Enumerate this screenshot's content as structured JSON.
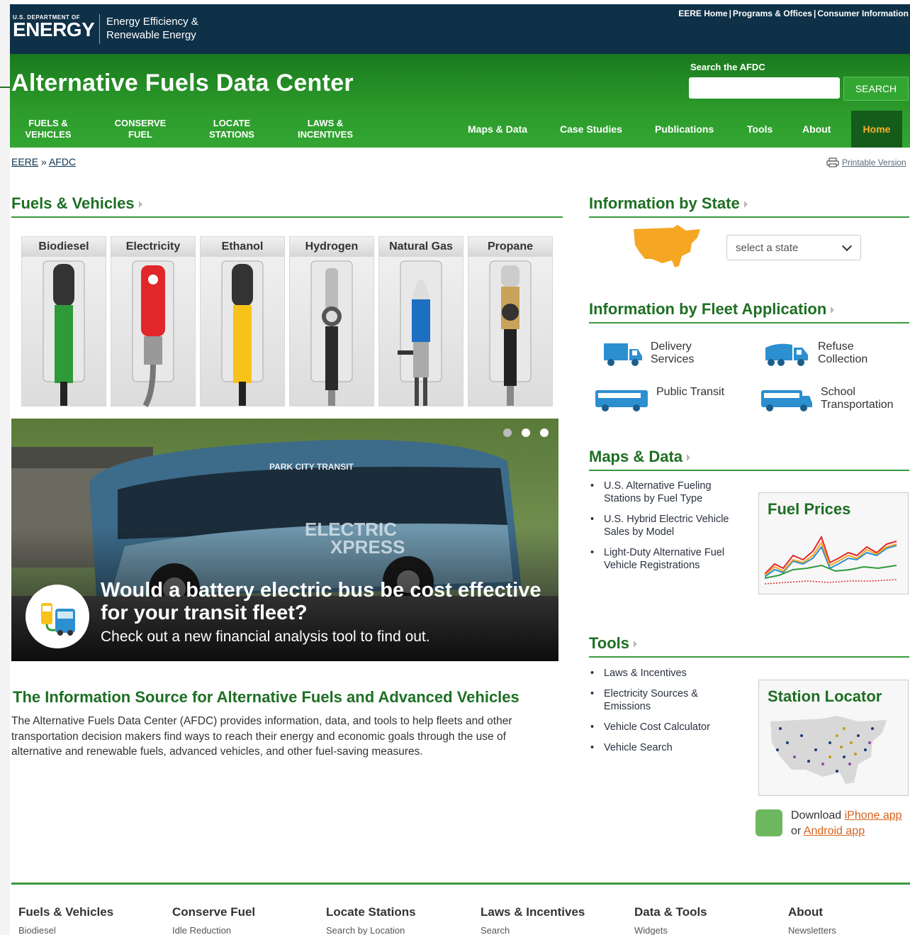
{
  "header": {
    "agency_small": "U.S. DEPARTMENT OF",
    "agency_big": "ENERGY",
    "office_line1": "Energy Efficiency &",
    "office_line2": "Renewable Energy",
    "top_links": [
      "EERE Home",
      "Programs & Offices",
      "Consumer Information"
    ],
    "site_title": "Alternative Fuels Data Center",
    "search_label": "Search the AFDC",
    "search_value": "",
    "search_button": "SEARCH"
  },
  "nav": {
    "primary": [
      {
        "line1": "FUELS &",
        "line2": "VEHICLES"
      },
      {
        "line1": "CONSERVE",
        "line2": "FUEL"
      },
      {
        "line1": "LOCATE",
        "line2": "STATIONS"
      },
      {
        "line1": "LAWS &",
        "line2": "INCENTIVES"
      }
    ],
    "secondary": [
      "Maps & Data",
      "Case Studies",
      "Publications",
      "Tools",
      "About"
    ],
    "home": "Home"
  },
  "breadcrumb": {
    "items": [
      "EERE",
      "AFDC"
    ],
    "separator": "»"
  },
  "printable": "Printable Version",
  "fuels_section": {
    "heading": "Fuels & Vehicles",
    "fuels": [
      {
        "label": "Biodiesel",
        "color": "#2e9a3a"
      },
      {
        "label": "Electricity",
        "color": "#e2272a"
      },
      {
        "label": "Ethanol",
        "color": "#f7c21a"
      },
      {
        "label": "Hydrogen",
        "color": "#9a9a9a"
      },
      {
        "label": "Natural Gas",
        "color": "#1d6fc2"
      },
      {
        "label": "Propane",
        "color": "#c9a35a"
      }
    ]
  },
  "hero": {
    "headline_line1": "Would a battery electric bus be cost effective",
    "headline_line2": "for your transit fleet?",
    "subtext": "Check out a new financial analysis tool to find out.",
    "bus_texts": {
      "brand": "PARK CITY TRANSIT",
      "name1": "ELECTRIC",
      "name2": "XPRESS"
    },
    "slide_count": 3,
    "active_slide": 1
  },
  "intro": {
    "heading": "The Information Source for Alternative Fuels and Advanced Vehicles",
    "paragraph": "The Alternative Fuels Data Center (AFDC) provides information, data, and tools to help fleets and other transportation decision makers find ways to reach their energy and economic goals through the use of alternative and renewable fuels, advanced vehicles, and other fuel-saving measures."
  },
  "state_section": {
    "heading": "Information by State",
    "select_placeholder": "select a state"
  },
  "fleet_section": {
    "heading": "Information by Fleet Application",
    "items": [
      {
        "line1": "Delivery",
        "line2": "Services"
      },
      {
        "line1": "Refuse",
        "line2": "Collection"
      },
      {
        "line1": "Public Transit",
        "line2": ""
      },
      {
        "line1": "School",
        "line2": "Transportation"
      }
    ]
  },
  "maps_section": {
    "heading": "Maps & Data",
    "links": [
      {
        "line1": "U.S. Alternative Fueling",
        "line2": "Stations by Fuel Type"
      },
      {
        "line1": "U.S. Hybrid Electric Vehicle",
        "line2": "Sales by Model"
      },
      {
        "line1": "Light-Duty Alternative Fuel",
        "line2": "Vehicle Registrations"
      }
    ],
    "card_title": "Fuel Prices"
  },
  "tools_section": {
    "heading": "Tools",
    "links": [
      {
        "line1": "Laws & Incentives",
        "line2": ""
      },
      {
        "line1": "Electricity Sources &",
        "line2": "Emissions"
      },
      {
        "line1": "Vehicle Cost Calculator",
        "line2": ""
      },
      {
        "line1": "Vehicle Search",
        "line2": ""
      }
    ],
    "card_title": "Station Locator"
  },
  "app": {
    "prefix": "Download ",
    "iphone": "iPhone app",
    "middle": "or ",
    "android": "Android app"
  },
  "footer": [
    {
      "heading": "Fuels & Vehicles",
      "first": "Biodiesel"
    },
    {
      "heading": "Conserve Fuel",
      "first": "Idle Reduction"
    },
    {
      "heading": "Locate Stations",
      "first": "Search by Location"
    },
    {
      "heading": "Laws & Incentives",
      "first": "Search"
    },
    {
      "heading": "Data & Tools",
      "first": "Widgets"
    },
    {
      "heading": "About",
      "first": "Newsletters"
    }
  ]
}
